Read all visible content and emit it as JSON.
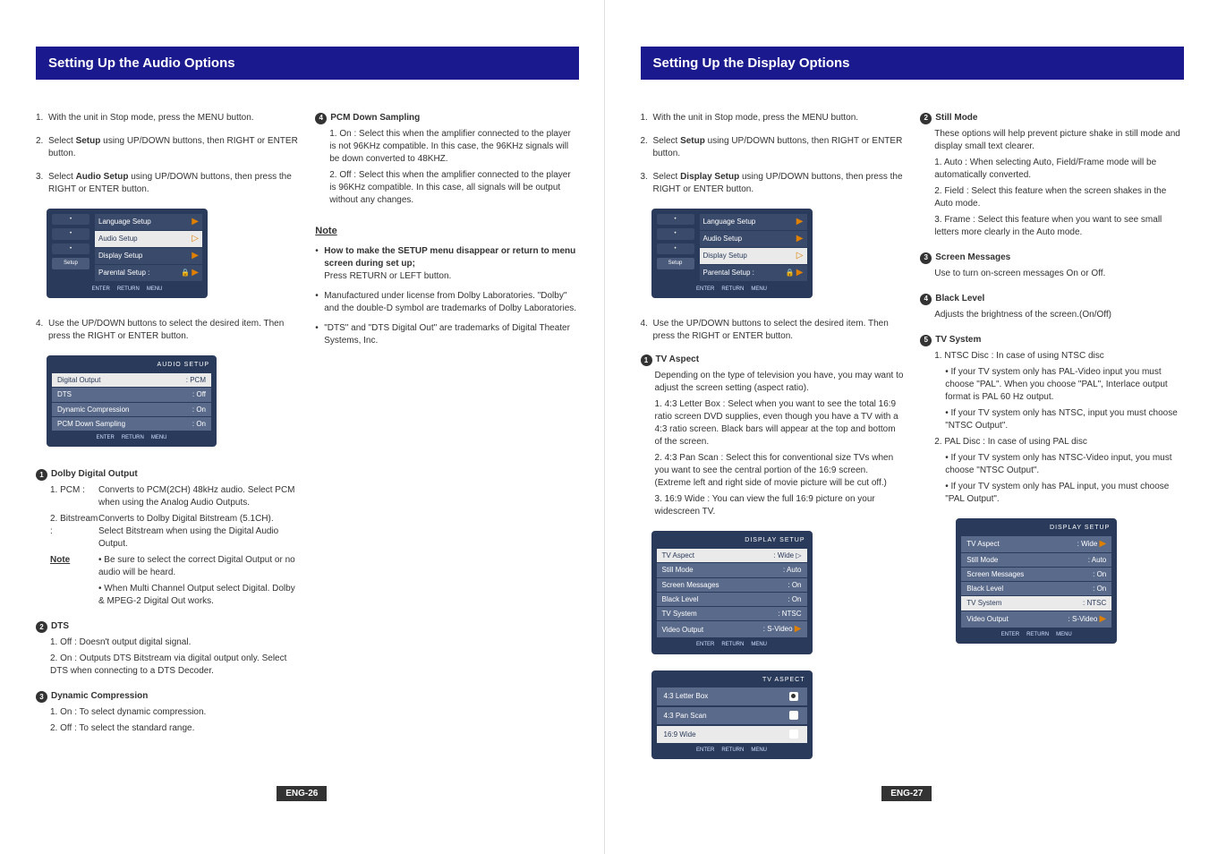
{
  "left": {
    "header": "Setting Up the Audio Options",
    "steps": [
      "1. With the unit in Stop mode, press the MENU button.",
      "2. Select **Setup** using UP/DOWN buttons, then RIGHT or ENTER button.",
      "3. Select **Audio Setup** using UP/DOWN buttons, then press the RIGHT or ENTER button."
    ],
    "step4": "4. Use the UP/DOWN buttons to select the desired item. Then press the RIGHT or ENTER button.",
    "menu": {
      "side_setup": "Setup",
      "items": [
        {
          "label": "Language Setup",
          "hl": false,
          "arrow": true
        },
        {
          "label": "Audio Setup",
          "hl": true,
          "arrow": true
        },
        {
          "label": "Display Setup",
          "hl": false,
          "arrow": true
        },
        {
          "label": "Parental Setup :",
          "hl": false,
          "arrow": true,
          "icon": "lock"
        }
      ],
      "footer": [
        "ENTER",
        "RETURN",
        "MENU"
      ]
    },
    "audio_setup_shot": {
      "title": "AUDIO SETUP",
      "rows": [
        {
          "label": "Digital Output",
          "val": "PCM",
          "hl": true
        },
        {
          "label": "DTS",
          "val": "Off",
          "hl": false
        },
        {
          "label": "Dynamic Compression",
          "val": "On",
          "hl": false
        },
        {
          "label": "PCM Down Sampling",
          "val": "On",
          "hl": false
        }
      ],
      "footer": [
        "ENTER",
        "RETURN",
        "MENU"
      ]
    },
    "sub1": {
      "num": "1",
      "title": "Dolby Digital Output",
      "items": [
        {
          "pre": "1. PCM :",
          "text": "Converts to PCM(2CH) 48kHz audio. Select PCM when using the Analog Audio Outputs."
        },
        {
          "pre": "2. Bitstream :",
          "text": "Converts to Dolby Digital Bitstream (5.1CH). Select Bitstream when using the Digital Audio Output."
        }
      ],
      "note_label": "Note",
      "note1": "• Be sure to select the correct Digital Output or no audio will be heard.",
      "note2": "• When Multi Channel Output select Digital. Dolby & MPEG-2 Digital Out works."
    },
    "sub2": {
      "num": "2",
      "title": "DTS",
      "items": [
        "1. Off : Doesn't output digital signal.",
        "2. On : Outputs DTS Bitstream via digital output only. Select DTS when connecting to a DTS Decoder."
      ]
    },
    "sub3": {
      "num": "3",
      "title": "Dynamic Compression",
      "items": [
        "1. On : To select dynamic compression.",
        "2. Off : To select the standard range."
      ]
    },
    "sub4": {
      "num": "4",
      "title": "PCM Down Sampling",
      "items": [
        "1. On : Select this when the amplifier connected to the player is not 96KHz compatible. In this case, the 96KHz signals will be down converted to 48KHZ.",
        "2. Off : Select this when the amplifier connected to the player is 96KHz compatible. In this case, all signals will be output without any changes."
      ]
    },
    "note_head": "Note",
    "notes": [
      {
        "bold": "How to make the SETUP menu disappear or return to menu screen during set up;",
        "plain": "Press RETURN or LEFT button."
      },
      {
        "bold": "",
        "plain": "Manufactured under license from Dolby Laboratories. \"Dolby\" and the double-D symbol are trademarks of Dolby Laboratories."
      },
      {
        "bold": "",
        "plain": "\"DTS\" and \"DTS Digital Out\" are trademarks of Digital Theater Systems, Inc."
      }
    ],
    "page_num": "ENG-26"
  },
  "right": {
    "header": "Setting Up the Display Options",
    "steps": [
      "1. With the unit in Stop mode, press the MENU button.",
      "2. Select **Setup** using UP/DOWN buttons, then RIGHT or ENTER button.",
      "3. Select **Display Setup** using UP/DOWN buttons, then press the RIGHT or ENTER button."
    ],
    "step4": "4. Use the UP/DOWN buttons to select the desired item. Then press the RIGHT or ENTER button.",
    "menu": {
      "side_setup": "Setup",
      "items": [
        {
          "label": "Language Setup",
          "hl": false,
          "arrow": true
        },
        {
          "label": "Audio Setup",
          "hl": false,
          "arrow": true
        },
        {
          "label": "Display Setup",
          "hl": true,
          "arrow": true
        },
        {
          "label": "Parental Setup :",
          "hl": false,
          "arrow": true,
          "icon": "lock"
        }
      ],
      "footer": [
        "ENTER",
        "RETURN",
        "MENU"
      ]
    },
    "sub1": {
      "num": "1",
      "title": "TV Aspect",
      "intro": "Depending on the type of television you have, you may want to adjust the screen setting (aspect ratio).",
      "items": [
        "1. 4:3 Letter Box : Select when you want to see the total 16:9 ratio screen DVD supplies, even though you have a TV with a 4:3 ratio screen. Black bars will appear at the top and bottom of the screen.",
        "2. 4:3 Pan Scan : Select this for conventional size TVs when you want to see the central portion of the 16:9 screen. (Extreme left and right side of movie picture will be cut off.)",
        "3. 16:9 Wide : You can view the full 16:9 picture on your widescreen TV."
      ]
    },
    "display_shot": {
      "title": "DISPLAY SETUP",
      "rows": [
        {
          "label": "TV Aspect",
          "val": "Wide",
          "hl": true,
          "arrow": true
        },
        {
          "label": "Still Mode",
          "val": "Auto",
          "hl": false
        },
        {
          "label": "Screen Messages",
          "val": "On",
          "hl": false
        },
        {
          "label": "Black Level",
          "val": "On",
          "hl": false
        },
        {
          "label": "TV System",
          "val": "NTSC",
          "hl": false
        },
        {
          "label": "Video Output",
          "val": "S-Video",
          "hl": false,
          "arrow": true
        }
      ],
      "footer": [
        "ENTER",
        "RETURN",
        "MENU"
      ]
    },
    "aspect_shot": {
      "title": "TV ASPECT",
      "rows": [
        {
          "label": "4:3 Letter Box",
          "sel": true,
          "hl": false
        },
        {
          "label": "4:3 Pan Scan",
          "sel": false,
          "hl": false
        },
        {
          "label": "16:9 Wide",
          "sel": false,
          "hl": true
        }
      ],
      "footer": [
        "ENTER",
        "RETURN",
        "MENU"
      ]
    },
    "sub2": {
      "num": "2",
      "title": "Still Mode",
      "intro": "These options will help prevent picture shake in still mode and display small text clearer.",
      "items": [
        "1. Auto : When selecting Auto, Field/Frame mode will be automatically converted.",
        "2. Field : Select this feature when the screen shakes in the Auto mode.",
        "3. Frame : Select this feature when you want to see small letters more clearly in the Auto mode."
      ]
    },
    "sub3": {
      "num": "3",
      "title": "Screen Messages",
      "text": "Use to turn on-screen messages On or Off."
    },
    "sub4": {
      "num": "4",
      "title": "Black Level",
      "text": "Adjusts the brightness of the screen.(On/Off)"
    },
    "sub5": {
      "num": "5",
      "title": "TV System",
      "items": [
        "1. NTSC Disc : In case of using NTSC disc",
        "• If your TV system only has PAL-Video input you must choose \"PAL\". When you choose \"PAL\", Interlace output format is PAL 60 Hz output.",
        "• If your TV system only has NTSC, input you must choose \"NTSC Output\".",
        "2. PAL Disc : In case of using PAL disc",
        "• If your TV system only has NTSC-Video input, you must choose \"NTSC Output\".",
        "• If your TV system only has PAL input, you must choose \"PAL Output\"."
      ]
    },
    "display_shot2": {
      "title": "DISPLAY SETUP",
      "rows": [
        {
          "label": "TV Aspect",
          "val": "Wide",
          "hl": false,
          "arrow": true
        },
        {
          "label": "Still Mode",
          "val": "Auto",
          "hl": false
        },
        {
          "label": "Screen Messages",
          "val": "On",
          "hl": false
        },
        {
          "label": "Black Level",
          "val": "On",
          "hl": false
        },
        {
          "label": "TV System",
          "val": "NTSC",
          "hl": true
        },
        {
          "label": "Video Output",
          "val": "S-Video",
          "hl": false,
          "arrow": true
        }
      ],
      "footer": [
        "ENTER",
        "RETURN",
        "MENU"
      ]
    },
    "page_num": "ENG-27"
  }
}
